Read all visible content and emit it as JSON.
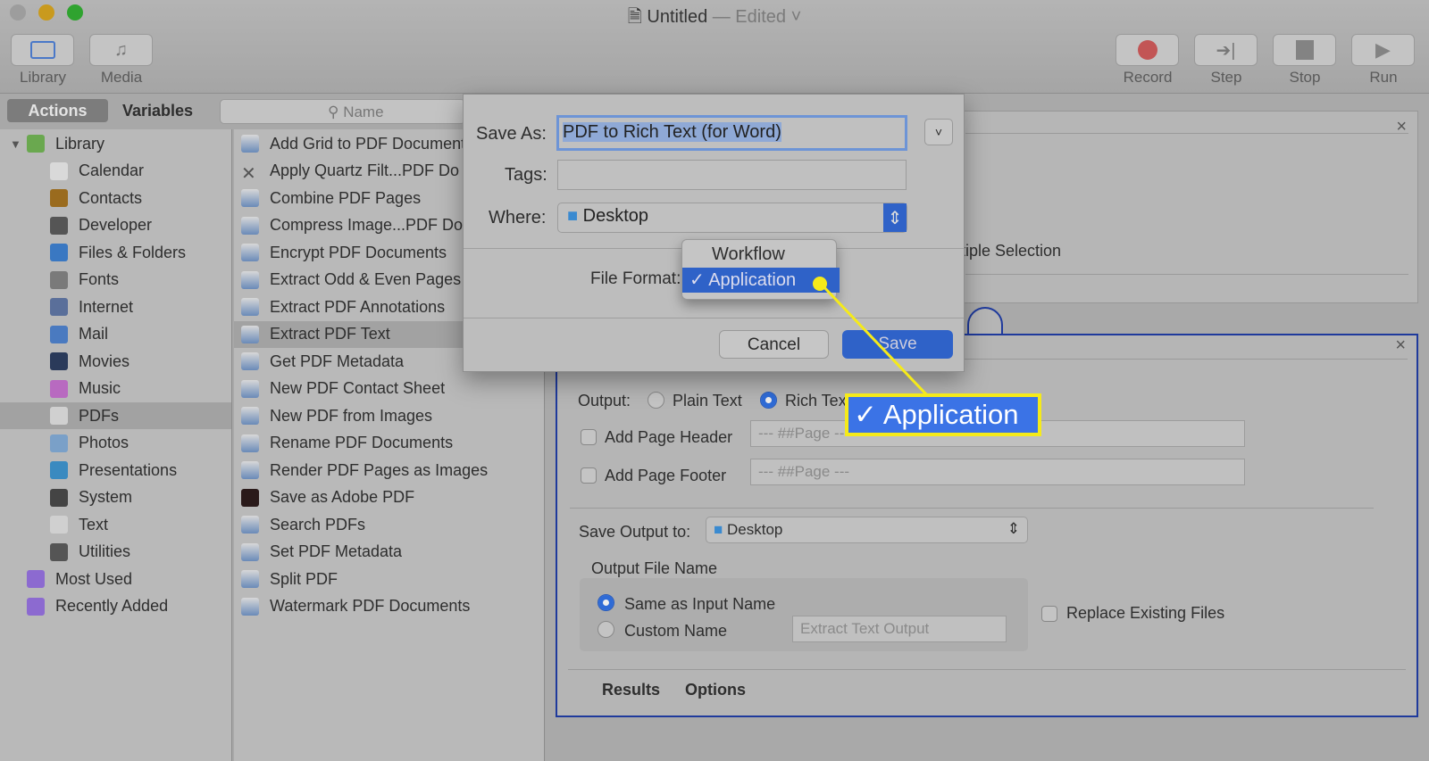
{
  "window": {
    "title": "Untitled",
    "status": "— Edited"
  },
  "toolbar": {
    "library": "Library",
    "media": "Media",
    "record": "Record",
    "step": "Step",
    "stop": "Stop",
    "run": "Run"
  },
  "tabs": {
    "actions": "Actions",
    "variables": "Variables"
  },
  "search": {
    "placeholder": "Name"
  },
  "sidebar": {
    "items": [
      {
        "label": "Library",
        "color": "#6aa84f"
      },
      {
        "label": "Calendar",
        "color": "#d9d9d9"
      },
      {
        "label": "Contacts",
        "color": "#9a6b1e"
      },
      {
        "label": "Developer",
        "color": "#555555"
      },
      {
        "label": "Files & Folders",
        "color": "#3a78c2"
      },
      {
        "label": "Fonts",
        "color": "#7a7a7a"
      },
      {
        "label": "Internet",
        "color": "#5a6f9a"
      },
      {
        "label": "Mail",
        "color": "#4a7ac0"
      },
      {
        "label": "Movies",
        "color": "#2a3a5a"
      },
      {
        "label": "Music",
        "color": "#b86ac0"
      },
      {
        "label": "PDFs",
        "color": "#d0d0d0"
      },
      {
        "label": "Photos",
        "color": "#7aa0c8"
      },
      {
        "label": "Presentations",
        "color": "#3a8ac0"
      },
      {
        "label": "System",
        "color": "#444444"
      },
      {
        "label": "Text",
        "color": "#d0d0d0"
      },
      {
        "label": "Utilities",
        "color": "#555555"
      },
      {
        "label": "Most Used",
        "color": "#8c6ad0"
      },
      {
        "label": "Recently Added",
        "color": "#8c6ad0"
      }
    ],
    "selected": "PDFs"
  },
  "actions_list": {
    "items": [
      "Add Grid to PDF Documents",
      "Apply Quartz Filt...PDF Do",
      "Combine PDF Pages",
      "Compress Image...PDF Do",
      "Encrypt PDF Documents",
      "Extract Odd & Even Pages",
      "Extract PDF Annotations",
      "Extract PDF Text",
      "Get PDF Metadata",
      "New PDF Contact Sheet",
      "New PDF from Images",
      "Rename PDF Documents",
      "Render PDF Pages as Images",
      "Save as Adobe PDF",
      "Search PDFs",
      "Set PDF Metadata",
      "Split PDF",
      "Watermark PDF Documents"
    ],
    "selected": "Extract PDF Text"
  },
  "dialog": {
    "save_as_label": "Save As:",
    "save_as_value": "PDF to Rich Text (for Word)",
    "tags_label": "Tags:",
    "where_label": "Where:",
    "where_value": "Desktop",
    "file_format_label": "File Format:",
    "cancel": "Cancel",
    "save": "Save",
    "format_options": [
      "Workflow",
      "Application"
    ],
    "format_selected": "Application",
    "check": "✓"
  },
  "workflow": {
    "box1_partial_text": "tiple Selection",
    "output_label": "Output:",
    "plain_text": "Plain Text",
    "rich_text": "Rich Text",
    "output_selected": "Rich Text",
    "add_header": "Add Page Header",
    "header_placeholder": "--- ##Page ---",
    "add_footer": "Add Page Footer",
    "footer_placeholder": "--- ##Page ---",
    "save_output_label": "Save Output to:",
    "save_output_value": "Desktop",
    "output_file_name": "Output File Name",
    "same_as_input": "Same as Input Name",
    "custom_name": "Custom Name",
    "custom_placeholder": "Extract Text Output",
    "replace_existing": "Replace Existing Files",
    "results": "Results",
    "options": "Options",
    "close": "×"
  },
  "callout": {
    "text": "✓ Application",
    "color": "#f5ea1a"
  },
  "colors": {
    "accent": "#2f6bd6",
    "highlight_border": "#1f3a9c"
  }
}
